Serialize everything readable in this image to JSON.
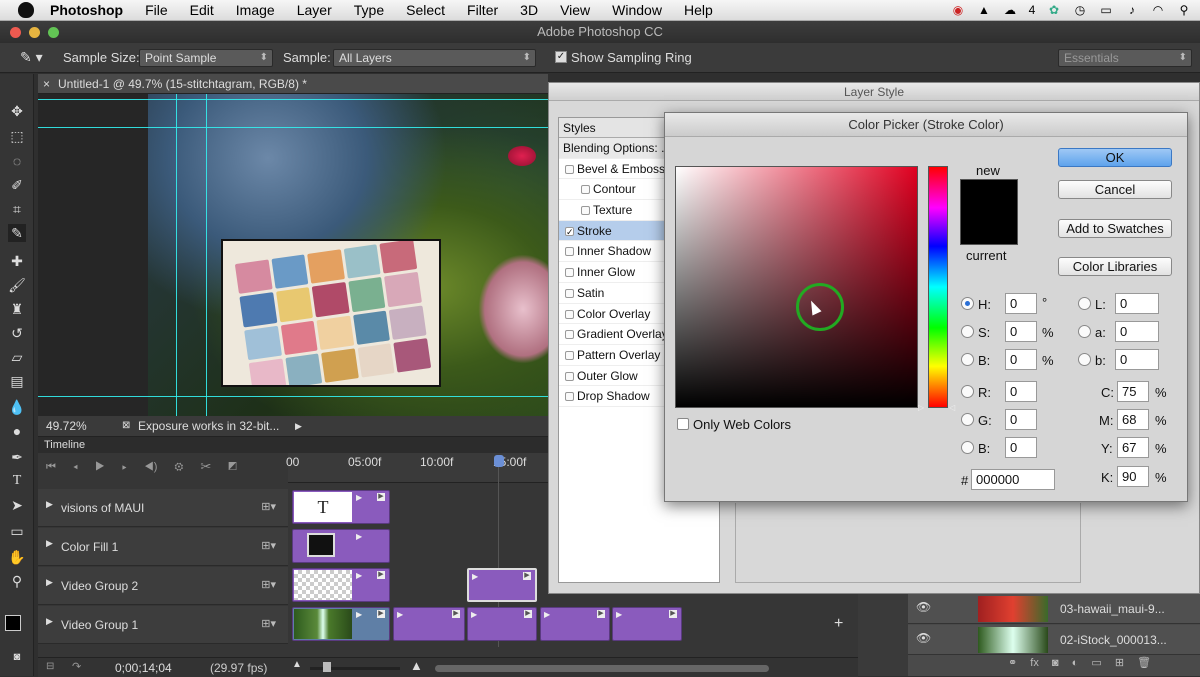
{
  "menubar": {
    "app": "Photoshop",
    "items": [
      "File",
      "Edit",
      "Image",
      "Layer",
      "Type",
      "Select",
      "Filter",
      "3D",
      "View",
      "Window",
      "Help"
    ],
    "tray_badge": "4"
  },
  "window": {
    "title": "Adobe Photoshop CC"
  },
  "options": {
    "sample_size_label": "Sample Size:",
    "sample_size_value": "Point Sample",
    "sample_label": "Sample:",
    "sample_value": "All Layers",
    "show_ring_label": "Show Sampling Ring",
    "workspace": "Essentials"
  },
  "document": {
    "tab_title": "Untitled-1 @ 49.7% (15-stitchtagram, RGB/8) *",
    "zoom": "49.72%",
    "status": "Exposure works in 32-bit..."
  },
  "timeline": {
    "title": "Timeline",
    "ruler": [
      "00",
      "05:00f",
      "10:00f",
      "15:00f"
    ],
    "tracks": [
      "visions of MAUI",
      "Color Fill 1",
      "Video Group 2",
      "Video Group 1"
    ],
    "timecode": "0;00;14;04",
    "fps": "(29.97 fps)",
    "type_clip_glyph": "T"
  },
  "layer_style": {
    "title": "Layer Style",
    "styles_head": "Styles",
    "blending": "Blending Options: ...",
    "items": [
      "Bevel & Emboss",
      "Contour",
      "Texture",
      "Stroke",
      "Inner Shadow",
      "Inner Glow",
      "Satin",
      "Color Overlay",
      "Gradient Overlay",
      "Pattern Overlay",
      "Outer Glow",
      "Drop Shadow"
    ],
    "selected": "Stroke"
  },
  "picker": {
    "title": "Color Picker (Stroke Color)",
    "new_label": "new",
    "current_label": "current",
    "ok": "OK",
    "cancel": "Cancel",
    "add_swatches": "Add to Swatches",
    "libraries": "Color Libraries",
    "only_web": "Only Web Colors",
    "h_label": "H:",
    "h": "0",
    "h_unit": "°",
    "s_label": "S:",
    "s": "0",
    "s_unit": "%",
    "b_label": "B:",
    "b": "0",
    "b_unit": "%",
    "r_label": "R:",
    "r": "0",
    "g_label": "G:",
    "g": "0",
    "bl_label": "B:",
    "bl": "0",
    "l_label": "L:",
    "l": "0",
    "a_label": "a:",
    "a": "0",
    "bb_label": "b:",
    "bb": "0",
    "c_label": "C:",
    "c": "75",
    "c_unit": "%",
    "m_label": "M:",
    "m": "68",
    "m_unit": "%",
    "y_label": "Y:",
    "y": "67",
    "y_unit": "%",
    "k_label": "K:",
    "k": "90",
    "k_unit": "%",
    "hex_label": "#",
    "hex": "000000",
    "current_color": "#000000"
  },
  "layers": {
    "rows": [
      "03-hawaii_maui-9...",
      "02-iStock_000013..."
    ]
  }
}
